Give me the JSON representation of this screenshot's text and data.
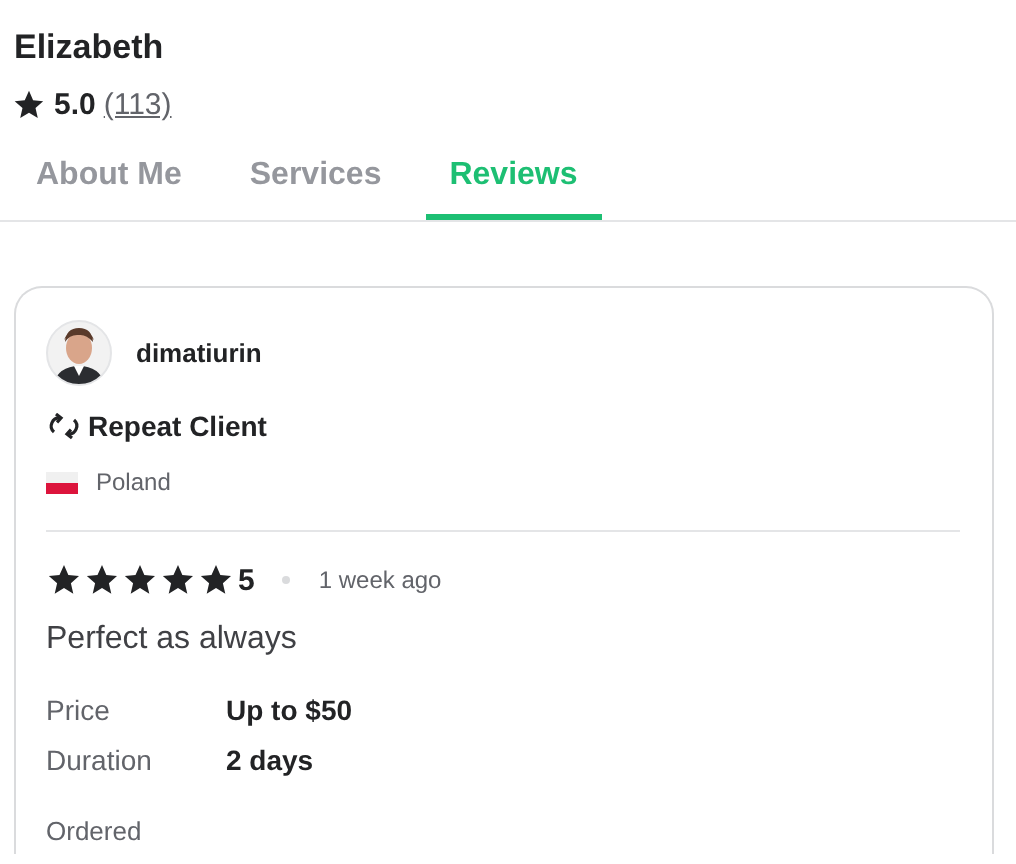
{
  "profile": {
    "name": "Elizabeth",
    "rating": "5.0",
    "review_count": "(113)"
  },
  "tabs": [
    {
      "label": "About Me",
      "selected": false
    },
    {
      "label": "Services",
      "selected": false
    },
    {
      "label": "Reviews",
      "selected": true
    }
  ],
  "review": {
    "reviewer": {
      "name": "dimatiurin",
      "badge": "Repeat Client",
      "country": "Poland"
    },
    "stars": 5,
    "score": "5",
    "time": "1 week ago",
    "text": "Perfect as always",
    "details": [
      {
        "label": "Price",
        "value": "Up to $50"
      },
      {
        "label": "Duration",
        "value": "2 days"
      }
    ],
    "ordered_label": "Ordered"
  }
}
